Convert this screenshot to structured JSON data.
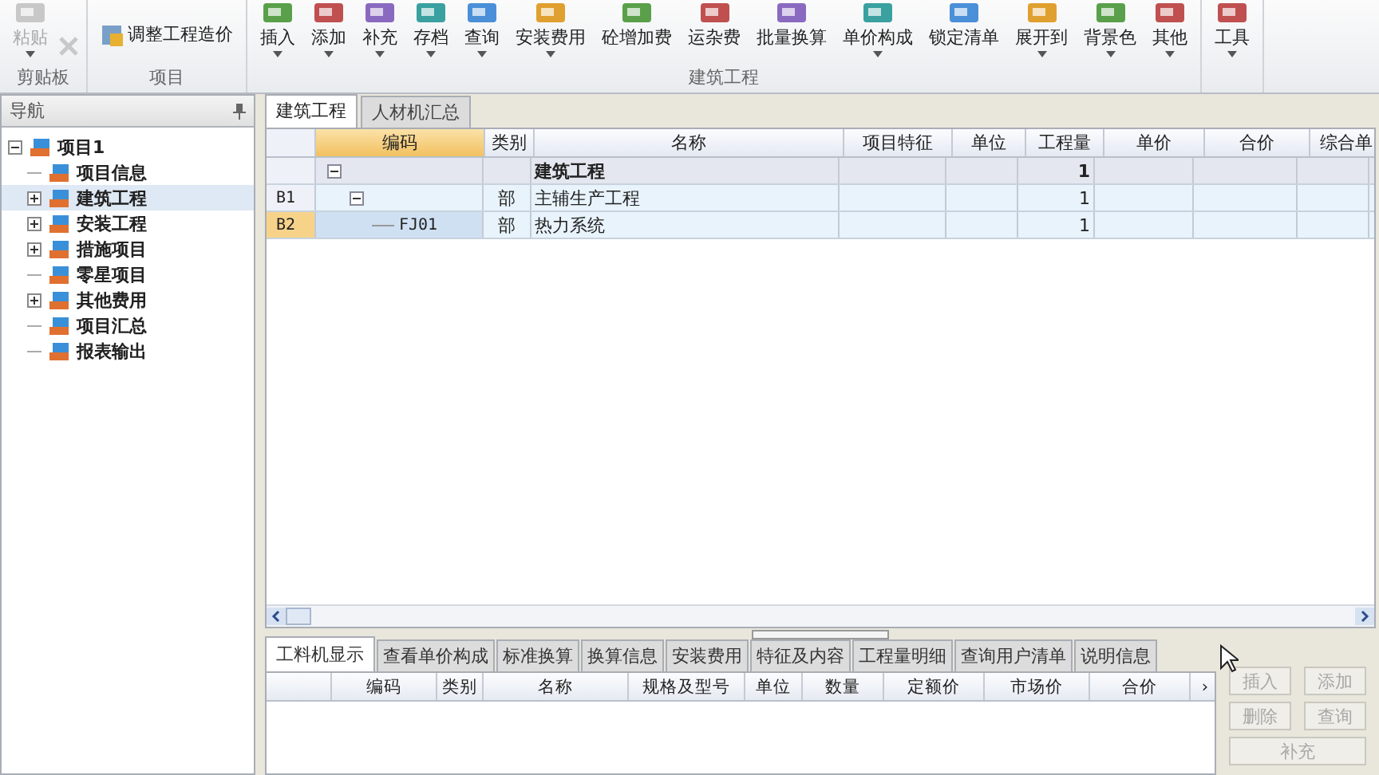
{
  "ribbon": {
    "groups": [
      {
        "label": "剪贴板",
        "buttons": [
          {
            "label": "粘贴",
            "dropdown": true,
            "disabled": true
          }
        ],
        "extra_disabled": true
      },
      {
        "label": "项目",
        "small_buttons": [
          "调整工程造价"
        ]
      },
      {
        "label": "建筑工程",
        "buttons": [
          {
            "label": "插入",
            "dropdown": true,
            "disabled": false
          },
          {
            "label": "添加",
            "dropdown": true,
            "disabled": false
          },
          {
            "label": "补充",
            "dropdown": true,
            "disabled": false
          },
          {
            "label": "存档",
            "dropdown": true,
            "disabled": false
          },
          {
            "label": "查询",
            "dropdown": true,
            "disabled": false
          },
          {
            "label": "安装费用",
            "dropdown": true,
            "disabled": false
          },
          {
            "label": "砼增加费",
            "dropdown": false,
            "disabled": false
          },
          {
            "label": "运杂费",
            "dropdown": false,
            "disabled": false
          },
          {
            "label": "批量换算",
            "dropdown": false,
            "disabled": false
          },
          {
            "label": "单价构成",
            "dropdown": true,
            "disabled": false
          },
          {
            "label": "锁定清单",
            "dropdown": false,
            "disabled": false
          },
          {
            "label": "展开到",
            "dropdown": true,
            "disabled": false
          },
          {
            "label": "背景色",
            "dropdown": true,
            "disabled": false
          },
          {
            "label": "其他",
            "dropdown": true,
            "disabled": false
          }
        ]
      },
      {
        "buttons": [
          {
            "label": "工具",
            "dropdown": true,
            "disabled": false
          }
        ]
      }
    ]
  },
  "navigation": {
    "title": "导航",
    "tree": [
      {
        "label": "项目1",
        "expanded": true,
        "selected": false,
        "children": [
          {
            "label": "项目信息",
            "selected": false
          },
          {
            "label": "建筑工程",
            "expanded": false,
            "selected": true
          },
          {
            "label": "安装工程",
            "expanded": false,
            "selected": false
          },
          {
            "label": "措施项目",
            "expanded": false,
            "selected": false
          },
          {
            "label": "零星项目",
            "selected": false
          },
          {
            "label": "其他费用",
            "expanded": false,
            "selected": false
          },
          {
            "label": "项目汇总",
            "selected": false
          },
          {
            "label": "报表输出",
            "selected": false
          }
        ]
      }
    ]
  },
  "tabs": [
    {
      "label": "建筑工程",
      "selected": true
    },
    {
      "label": "人材机汇总",
      "selected": false
    }
  ],
  "table": {
    "columns": [
      "编码",
      "类别",
      "名称",
      "项目特征",
      "单位",
      "工程量",
      "单价",
      "合价",
      "综合单"
    ],
    "rows": [
      {
        "name": "建筑工程",
        "quantity": "1",
        "kind": "project",
        "selected": false,
        "expanded": true,
        "children": [
          {
            "row_header": "B1",
            "type": "部",
            "name": "主辅生产工程",
            "quantity": "1",
            "kind": "section",
            "selected": false,
            "expanded": true,
            "children": [
              {
                "row_header": "B2",
                "code": "FJ01",
                "type": "部",
                "name": "热力系统",
                "quantity": "1",
                "kind": "section",
                "selected": true
              }
            ]
          }
        ]
      }
    ]
  },
  "detail_tabs": [
    {
      "label": "工料机显示",
      "selected": true
    },
    {
      "label": "查看单价构成",
      "selected": false
    },
    {
      "label": "标准换算",
      "selected": false
    },
    {
      "label": "换算信息",
      "selected": false
    },
    {
      "label": "安装费用",
      "selected": false
    },
    {
      "label": "特征及内容",
      "selected": false
    },
    {
      "label": "工程量明细",
      "selected": false
    },
    {
      "label": "查询用户清单",
      "selected": false
    },
    {
      "label": "说明信息",
      "selected": false
    }
  ],
  "detail_table": {
    "columns": [
      "编码",
      "类别",
      "名称",
      "规格及型号",
      "单位",
      "数量",
      "定额价",
      "市场价",
      "合价",
      "›"
    ]
  },
  "side_buttons": [
    {
      "label": "插入",
      "disabled": true
    },
    {
      "label": "添加",
      "disabled": true
    },
    {
      "label": "删除",
      "disabled": true
    },
    {
      "label": "查询",
      "disabled": true
    },
    {
      "label": "补充",
      "disabled": true
    }
  ]
}
